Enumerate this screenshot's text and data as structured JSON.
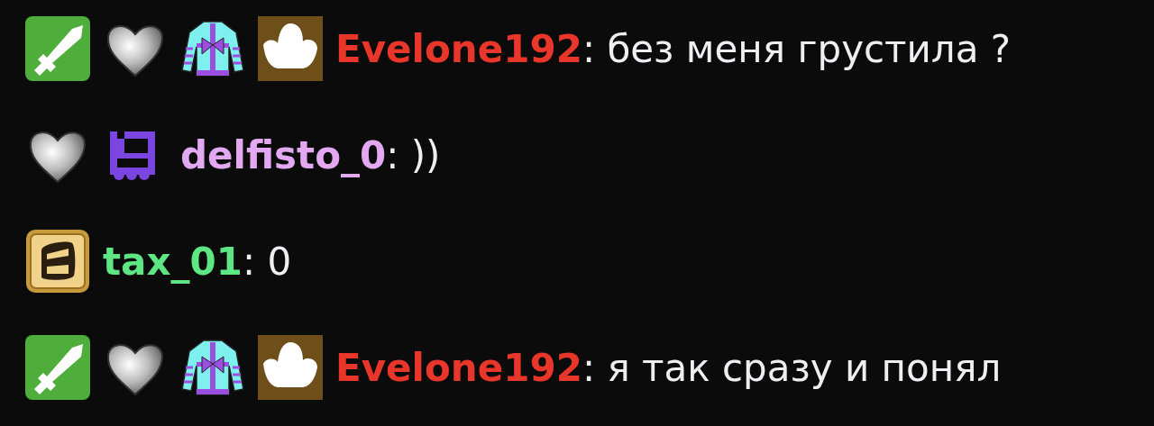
{
  "messages": [
    {
      "badges": [
        {
          "kind": "sword"
        },
        {
          "kind": "heart"
        },
        {
          "kind": "sweater"
        },
        {
          "kind": "cloud"
        }
      ],
      "username": "Evelone192",
      "color": "#e8362b",
      "separator": ":",
      "text": "без меня грустила ?"
    },
    {
      "badges": [
        {
          "kind": "heart"
        },
        {
          "kind": "train"
        }
      ],
      "username": "delfisto_0",
      "color": "#e2a9f1",
      "separator": ":",
      "text": "))"
    },
    {
      "badges": [
        {
          "kind": "gold"
        }
      ],
      "username": "tax_01",
      "color": "#5ee685",
      "separator": ":",
      "text": "0"
    },
    {
      "badges": [
        {
          "kind": "sword"
        },
        {
          "kind": "heart"
        },
        {
          "kind": "sweater"
        },
        {
          "kind": "cloud"
        }
      ],
      "username": "Evelone192",
      "color": "#e8362b",
      "separator": ":",
      "text": "я так сразу и понял"
    }
  ]
}
